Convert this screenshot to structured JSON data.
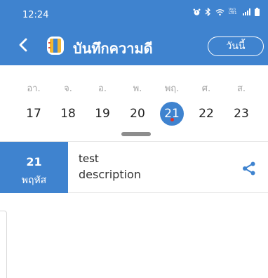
{
  "status_bar": {
    "time": "12:24",
    "icons": [
      "alarm-icon",
      "bluetooth-icon",
      "wifi-icon",
      "volte-lte-icon",
      "signal-icon",
      "battery-icon"
    ],
    "network_label": "Vo)) LTE1"
  },
  "app_bar": {
    "title": "บันทึกความดี",
    "today_label": "วันนี้",
    "back_icon": "chevron-left-icon",
    "logo_icon": "notebook-logo-icon"
  },
  "week": {
    "weekdays": [
      "อา.",
      "จ.",
      "อ.",
      "พ.",
      "พฤ.",
      "ศ.",
      "ส."
    ],
    "dates": [
      "17",
      "18",
      "19",
      "20",
      "21",
      "22",
      "23"
    ],
    "selected_index": 4,
    "event_dot_index": 4
  },
  "event": {
    "date_num": "21",
    "date_day": "พฤหัส",
    "title": "test",
    "description": "description",
    "share_icon": "share-icon"
  },
  "colors": {
    "primary": "#3f83cf",
    "dot": "#e0302a",
    "weekday_text": "#a3a3a3"
  }
}
